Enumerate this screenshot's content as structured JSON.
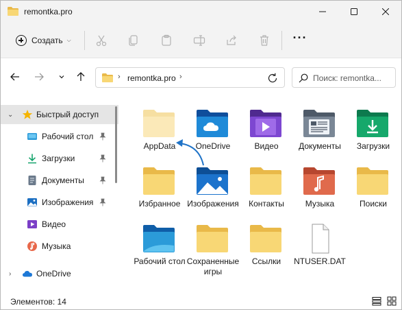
{
  "window": {
    "title": "remontka.pro",
    "controls": [
      "minimize",
      "maximize",
      "close"
    ]
  },
  "commandbar": {
    "create_label": "Создать",
    "icons": [
      "cut-icon",
      "copy-icon",
      "paste-icon",
      "rename-icon",
      "share-icon",
      "delete-icon"
    ],
    "more_label": "···"
  },
  "address": {
    "path": "remontka.pro",
    "search_placeholder": "Поиск: remontka..."
  },
  "sidebar": {
    "items": [
      {
        "label": "Быстрый доступ",
        "icon": "star-icon",
        "pinned": false,
        "selected": true
      },
      {
        "label": "Рабочий стол",
        "icon": "desktop-icon",
        "pinned": true
      },
      {
        "label": "Загрузки",
        "icon": "download-icon",
        "pinned": true
      },
      {
        "label": "Документы",
        "icon": "documents-icon",
        "pinned": true
      },
      {
        "label": "Изображения",
        "icon": "pictures-icon",
        "pinned": true
      },
      {
        "label": "Видео",
        "icon": "video-icon",
        "pinned": false
      },
      {
        "label": "Музыка",
        "icon": "music-icon",
        "pinned": false
      },
      {
        "label": "OneDrive",
        "icon": "cloud-icon",
        "pinned": false
      }
    ]
  },
  "items": [
    {
      "label": "AppData",
      "icon": "folder-hidden-icon"
    },
    {
      "label": "OneDrive",
      "icon": "folder-onedrive-icon"
    },
    {
      "label": "Видео",
      "icon": "folder-video-icon"
    },
    {
      "label": "Документы",
      "icon": "folder-documents-icon"
    },
    {
      "label": "Загрузки",
      "icon": "folder-downloads-icon"
    },
    {
      "label": "Избранное",
      "icon": "folder-icon"
    },
    {
      "label": "Изображения",
      "icon": "folder-pictures-icon"
    },
    {
      "label": "Контакты",
      "icon": "folder-icon"
    },
    {
      "label": "Музыка",
      "icon": "folder-music-icon"
    },
    {
      "label": "Поиски",
      "icon": "folder-icon"
    },
    {
      "label": "Рабочий стол",
      "icon": "folder-desktop-icon"
    },
    {
      "label": "Сохраненные игры",
      "icon": "folder-icon"
    },
    {
      "label": "Ссылки",
      "icon": "folder-icon"
    },
    {
      "label": "NTUSER.DAT",
      "icon": "file-icon"
    }
  ],
  "status": {
    "items_count": "Элементов: 14"
  },
  "colors": {
    "folder_yellow": "#f8d775",
    "folder_yellow_dark": "#e9b949",
    "accent_blue": "#0a66c2",
    "annotation_arrow": "#1f73c7"
  }
}
